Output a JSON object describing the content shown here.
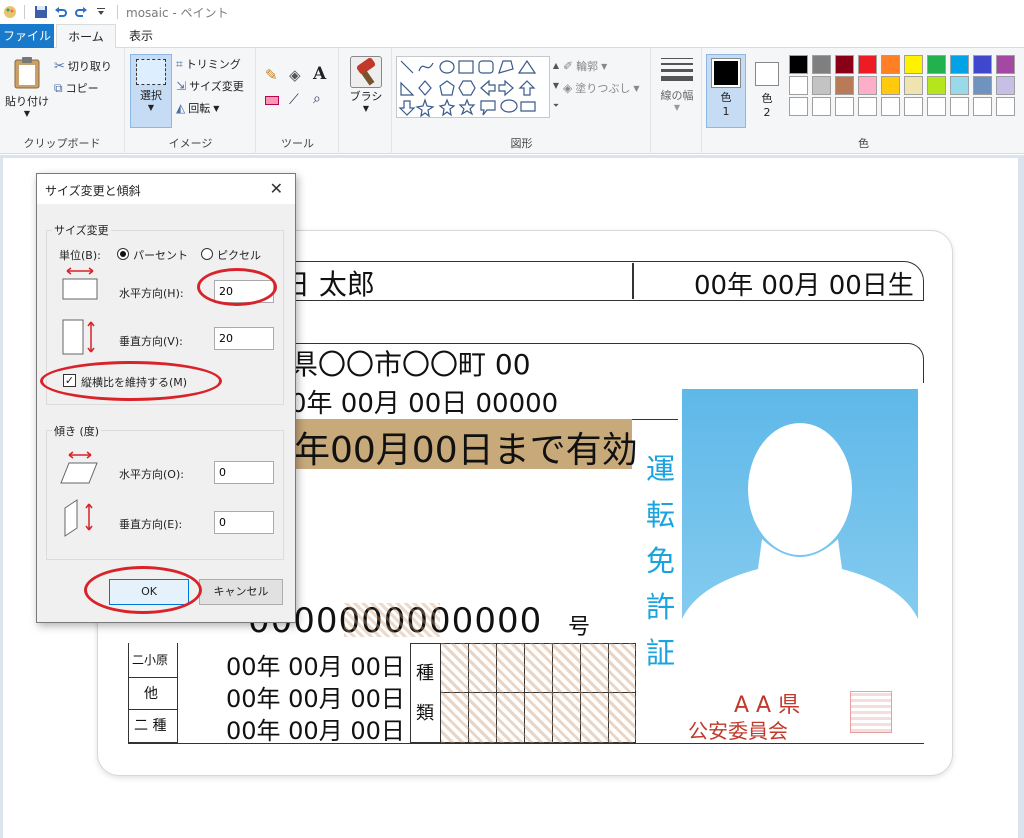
{
  "window": {
    "title": "mosaic - ペイント"
  },
  "tabs": {
    "file": "ファイル",
    "home": "ホーム",
    "view": "表示"
  },
  "clipboard": {
    "paste": "貼り付け",
    "cut": "切り取り",
    "copy": "コピー",
    "label": "クリップボード"
  },
  "image": {
    "select": "選択",
    "crop": "トリミング",
    "resize": "サイズ変更",
    "rotate": "回転",
    "label": "イメージ"
  },
  "tools": {
    "label": "ツール"
  },
  "brush": {
    "label": "ブラシ"
  },
  "shapes": {
    "outline": "輪郭",
    "fill": "塗りつぶし",
    "label": "図形"
  },
  "size": {
    "label": "線の幅"
  },
  "colors": {
    "color1_label": "色",
    "color1_num": "1",
    "color2_label": "色",
    "color2_num": "2",
    "label": "色",
    "color1": "#000000",
    "color2": "#ffffff",
    "palette_row1": [
      "#000000",
      "#7f7f7f",
      "#880015",
      "#ed1c24",
      "#ff7f27",
      "#fff200",
      "#22b14c",
      "#00a2e8",
      "#3f48cc",
      "#a349a4"
    ],
    "palette_row2": [
      "#ffffff",
      "#c3c3c3",
      "#b97a57",
      "#ffaec9",
      "#ffc90e",
      "#efe4b0",
      "#b5e61d",
      "#99d9ea",
      "#7092be",
      "#c8bfe7"
    ],
    "palette_row3": [
      "#ffffff",
      "#ffffff",
      "#ffffff",
      "#ffffff",
      "#ffffff",
      "#ffffff",
      "#ffffff",
      "#ffffff",
      "#ffffff",
      "#ffffff"
    ]
  },
  "dialog": {
    "title": "サイズ変更と傾斜",
    "resize_legend": "サイズ変更",
    "unit_label": "単位(B):",
    "percent": "パーセント",
    "pixel": "ピクセル",
    "horizontal_label": "水平方向(H):",
    "horizontal_value": "20",
    "vertical_label": "垂直方向(V):",
    "vertical_value": "20",
    "keep_ratio": "縦横比を維持する(M)",
    "skew_legend": "傾き (度)",
    "skew_h_label": "水平方向(O):",
    "skew_h_value": "0",
    "skew_v_label": "垂直方向(E):",
    "skew_v_value": "0",
    "ok": "OK",
    "cancel": "キャンセル"
  },
  "card": {
    "name": "日  太郎",
    "birth": "00年 00月 00日生",
    "address": "県〇〇市〇〇町 00",
    "issue": "0年 00月 00日  00000",
    "valid": "年00月00日まで有効",
    "vertical_title": "運転免許証",
    "number": "0000000000000",
    "number_suffix": "号",
    "cls1": "二小原",
    "cls2": "他",
    "cls3": "二 種",
    "date1": "00年 00月 00日",
    "date2": "00年 00月 00日",
    "date3": "00年 00月 00日",
    "kind1": "種",
    "kind2": "類",
    "authority1": "A A 県",
    "authority2": "公安委員会"
  }
}
